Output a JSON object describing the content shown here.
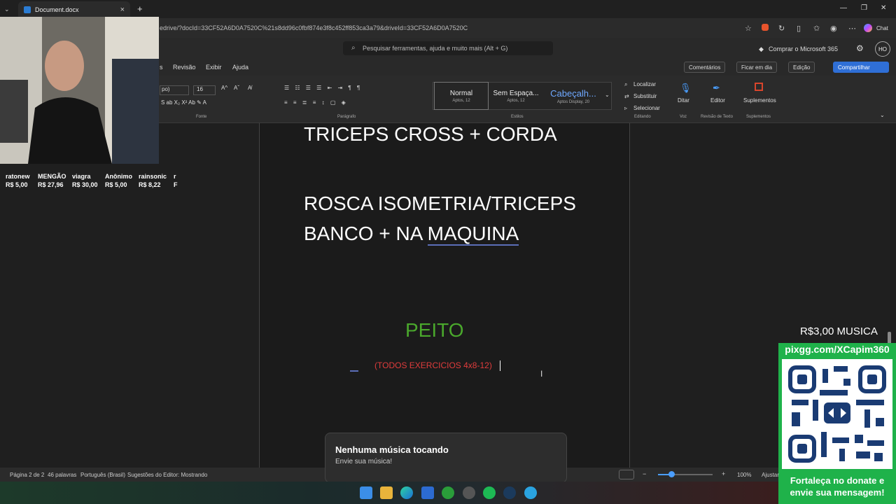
{
  "browser": {
    "tab_title": "Document.docx",
    "url": "edrive/?docId=33CF52A6D0A7520C%21s8dd96c0fbf874e3f8c452ff853ca3a79&driveId=33CF52A6D0A7520C",
    "chat_label": "Chat"
  },
  "word": {
    "search_placeholder": "Pesquisar ferramentas, ajuda e muito mais (Alt + G)",
    "buy_label": "Comprar o Microsoft 365",
    "avatar_initials": "HO",
    "menu": [
      "s",
      "Revisão",
      "Exibir",
      "Ajuda"
    ],
    "comments_label": "Comentários",
    "catchup_label": "Ficar em dia",
    "edit_label": "Edição",
    "share_label": "Compartilhar",
    "ribbon": {
      "font_name": "po)",
      "font_size": "16",
      "font_group": "Fonte",
      "paragraph_group": "Parágrafo",
      "styles_group": "Estilos",
      "editing_group": "Editando",
      "voice_group": "Voz",
      "review_group": "Revisão de Texto",
      "addins_group": "Suplementos",
      "styles": [
        {
          "name": "Normal",
          "sub": "Aptos, 12"
        },
        {
          "name": "Sem Espaça...",
          "sub": "Aptos, 12"
        },
        {
          "name": "Cabeçalh...",
          "sub": "Aptos Display, 20"
        }
      ],
      "find_label": "Localizar",
      "replace_label": "Substituir",
      "select_label": "Selecionar",
      "dictate_label": "Ditar",
      "editor_label": "Editor",
      "addins_label": "Suplementos"
    },
    "document": {
      "line1": "TRICEPS CROSS + CORDA",
      "line2": "ROSCA ISOMETRIA/TRICEPS",
      "line3a": "BANCO + NA ",
      "line3b": "MAQUINA",
      "heading": "PEITO",
      "note": "(TODOS EXERCICIOS 4x8-12)"
    },
    "status": {
      "page": "Página 2 de 2",
      "words": "46 palavras",
      "language": "Português (Brasil)",
      "editor": "Sugestões do Editor: Mostrando",
      "zoom": "100%",
      "fit": "Ajustar"
    }
  },
  "overlay": {
    "donors": [
      {
        "name": "ratonew",
        "amount": "R$ 5,00"
      },
      {
        "name": "MENGÃO",
        "amount": "R$ 27,96"
      },
      {
        "name": "viagra",
        "amount": "R$ 30,00"
      },
      {
        "name": "Anônimo",
        "amount": "R$ 5,00"
      },
      {
        "name": "rainsonic",
        "amount": "R$ 8,22"
      },
      {
        "name": "r",
        "amount": "F"
      }
    ],
    "music_price": "R$3,00 MUSICA",
    "pix_url": "pixgg.com/XCapim360",
    "donate_message": "Fortaleça no donate e envie sua mensagem!",
    "toast_title": "Nenhuma música tocando",
    "toast_subtitle": "Envie sua música!"
  }
}
